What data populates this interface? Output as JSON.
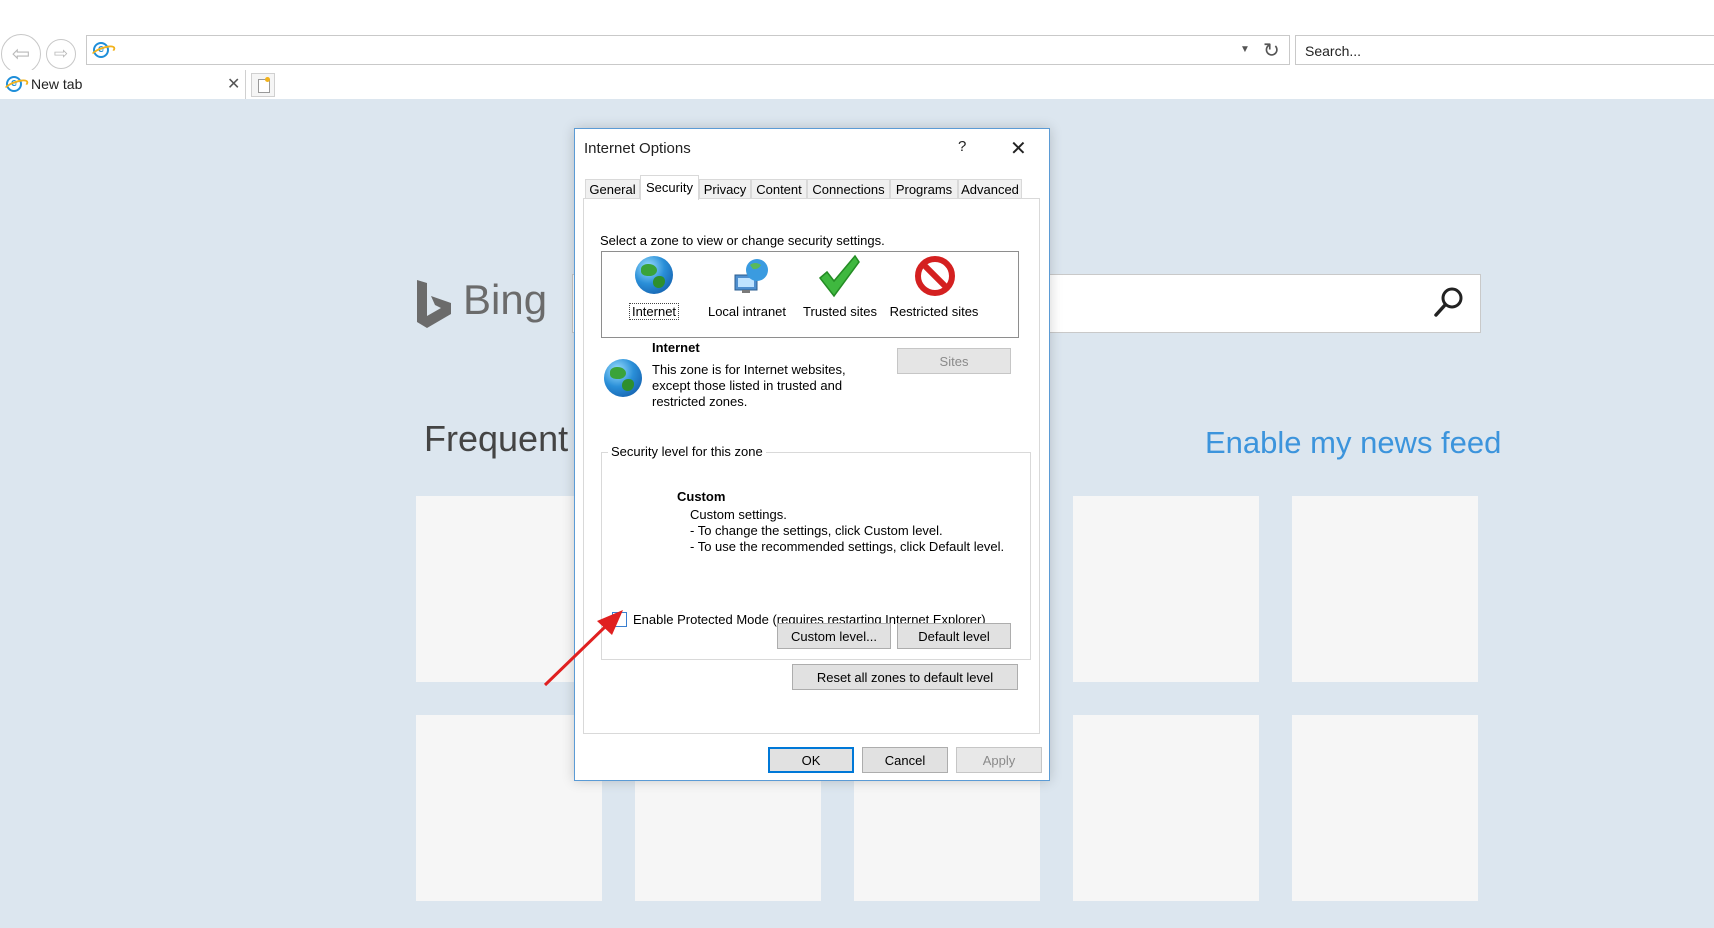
{
  "browser": {
    "address_value": "",
    "search_placeholder": "Search...",
    "tab_title": "New tab"
  },
  "newtab_page": {
    "brand": "Bing",
    "search_value": "",
    "frequent_heading": "Frequent",
    "news_feed_link": "Enable my news feed"
  },
  "dialog": {
    "title": "Internet Options",
    "help_glyph": "?",
    "close_glyph": "✕",
    "tabs": [
      "General",
      "Security",
      "Privacy",
      "Content",
      "Connections",
      "Programs",
      "Advanced"
    ],
    "active_tab": "Security",
    "zone_prompt": "Select a zone to view or change security settings.",
    "zones": [
      {
        "label": "Internet",
        "icon": "globe-icon",
        "selected": true
      },
      {
        "label": "Local intranet",
        "icon": "intranet-icon",
        "selected": false
      },
      {
        "label": "Trusted sites",
        "icon": "checkmark-icon",
        "selected": false
      },
      {
        "label": "Restricted sites",
        "icon": "prohibited-icon",
        "selected": false
      }
    ],
    "zone_info": {
      "name": "Internet",
      "line1": "This zone is for Internet websites,",
      "line2": "except those listed in trusted and",
      "line3": "restricted zones."
    },
    "sites_button": "Sites",
    "security_level": {
      "legend": "Security level for this zone",
      "level_name": "Custom",
      "line1": "Custom settings.",
      "line2": "- To change the settings, click Custom level.",
      "line3": "- To use the recommended settings, click Default level."
    },
    "protected_mode": {
      "label": "Enable Protected Mode (requires restarting Internet Explorer)",
      "checked": false
    },
    "custom_level_button": "Custom level...",
    "default_level_button": "Default level",
    "reset_button": "Reset all zones to default level",
    "ok_button": "OK",
    "cancel_button": "Cancel",
    "apply_button": "Apply"
  },
  "colors": {
    "page_background": "#dce6ef",
    "dialog_border": "#5b9bd5",
    "link_blue": "#3c94dc",
    "annotation_red": "#e02020"
  }
}
